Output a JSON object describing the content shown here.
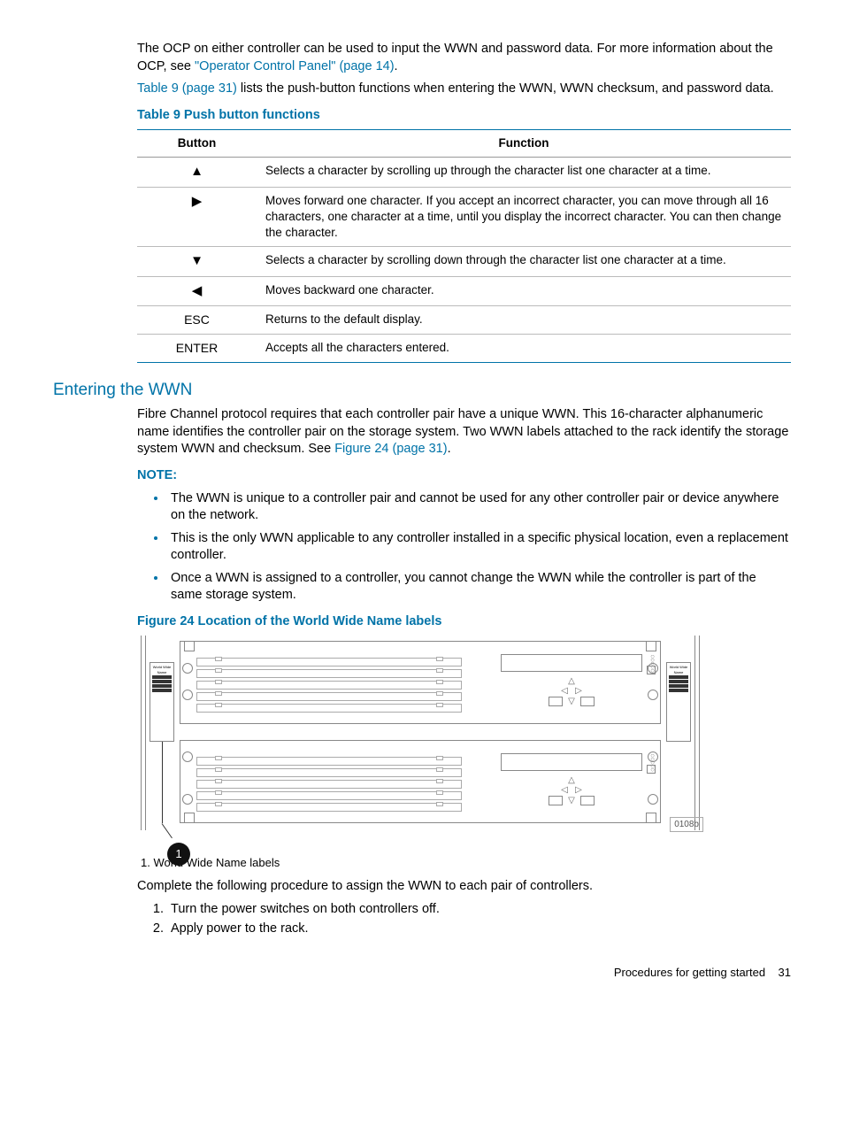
{
  "intro": {
    "p1a": "The OCP on either controller can be used to input the WWN and password data. For more information about the OCP, see ",
    "link1": "\"Operator Control Panel\" (page 14)",
    "p1b": ".",
    "p2a": "",
    "link2": "Table 9 (page 31)",
    "p2b": " lists the push-button functions when entering the WWN, WWN checksum, and password data."
  },
  "table9": {
    "caption": "Table 9 Push button functions",
    "head_button": "Button",
    "head_function": "Function",
    "rows": [
      {
        "btn_glyph": "▲",
        "btn_text": "",
        "fn": "Selects a character by scrolling up through the character list one character at a time."
      },
      {
        "btn_glyph": "▶",
        "btn_text": "",
        "fn": "Moves forward one character. If you accept an incorrect character, you can move through all 16 characters, one character at a time, until you display the incorrect character. You can then change the character."
      },
      {
        "btn_glyph": "▼",
        "btn_text": "",
        "fn": "Selects a character by scrolling down through the character list one character at a time."
      },
      {
        "btn_glyph": "◀",
        "btn_text": "",
        "fn": "Moves backward one character."
      },
      {
        "btn_glyph": "",
        "btn_text": "ESC",
        "fn": "Returns to the default display."
      },
      {
        "btn_glyph": "",
        "btn_text": "ENTER",
        "fn": "Accepts all the characters entered."
      }
    ]
  },
  "section": {
    "heading": "Entering the WWN",
    "para_a": "Fibre Channel protocol requires that each controller pair have a unique WWN. This 16-character alphanumeric name identifies the controller pair on the storage system. Two WWN labels attached to the rack identify the storage system WWN and checksum. See ",
    "para_link": "Figure 24 (page 31)",
    "para_b": "."
  },
  "note": {
    "heading": "NOTE:",
    "items": [
      "The WWN is unique to a controller pair and cannot be used for any other controller pair or device anywhere on the network.",
      "This is the only WWN applicable to any controller installed in a specific physical location, even a replacement controller.",
      "Once a WWN is assigned to a controller, you cannot change the WWN while the controller is part of the same storage system."
    ]
  },
  "figure": {
    "caption": "Figure 24 Location of the World Wide Name labels",
    "callout_num": "1",
    "drawing_id": "0108b",
    "label_title": "World Wide Name",
    "legend": "1. World Wide Name labels"
  },
  "procedure": {
    "intro": "Complete the following procedure to assign the WWN to each pair of controllers.",
    "steps": [
      "Turn the power switches on both controllers off.",
      "Apply power to the rack."
    ]
  },
  "footer": {
    "section": "Procedures for getting started",
    "page": "31"
  }
}
